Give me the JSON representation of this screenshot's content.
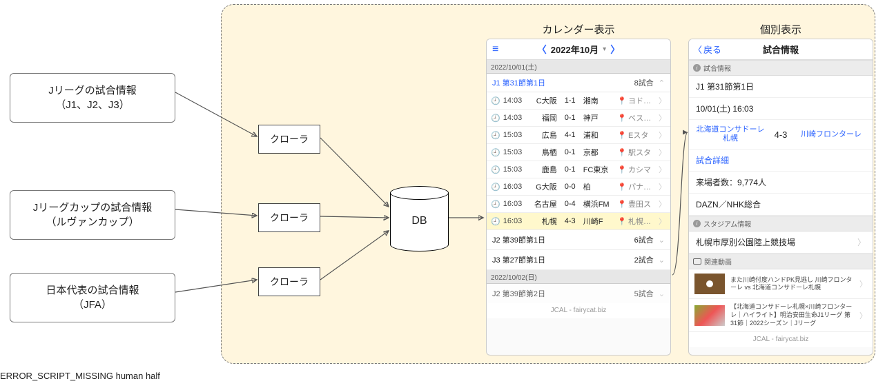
{
  "sources": [
    {
      "title": "Jリーグの試合情報",
      "subtitle": "（J1、J2、J3）"
    },
    {
      "title": "Jリーグカップの試合情報",
      "subtitle": "（ルヴァンカップ）"
    },
    {
      "title": "日本代表の試合情報",
      "subtitle": "（JFA）"
    }
  ],
  "crawler_label": "クローラ",
  "db_label": "DB",
  "calendar": {
    "panel_title": "カレンダー表示",
    "month": "2022年10月",
    "date_bar_1": "2022/10/01(土)",
    "section_j1": {
      "title": "J1 第31節第1日",
      "count": "8試合"
    },
    "rows": [
      {
        "time": "14:03",
        "home": "C大阪",
        "score": "1-1",
        "away": "湘南",
        "venue": "ヨドコウ"
      },
      {
        "time": "14:03",
        "home": "福岡",
        "score": "0-1",
        "away": "神戸",
        "venue": "ベススタ"
      },
      {
        "time": "15:03",
        "home": "広島",
        "score": "4-1",
        "away": "浦和",
        "venue": "Eスタ"
      },
      {
        "time": "15:03",
        "home": "鳥栖",
        "score": "0-1",
        "away": "京都",
        "venue": "駅スタ"
      },
      {
        "time": "15:03",
        "home": "鹿島",
        "score": "0-1",
        "away": "FC東京",
        "venue": "カシマ"
      },
      {
        "time": "16:03",
        "home": "G大阪",
        "score": "0-0",
        "away": "柏",
        "venue": "パナスタ"
      },
      {
        "time": "16:03",
        "home": "名古屋",
        "score": "0-4",
        "away": "横浜FM",
        "venue": "豊田ス"
      },
      {
        "time": "16:03",
        "home": "札幌",
        "score": "4-3",
        "away": "川崎F",
        "venue": "札幌厚別"
      }
    ],
    "block_j2": {
      "title": "J2 第39節第1日",
      "count": "6試合"
    },
    "block_j3": {
      "title": "J3 第27節第1日",
      "count": "2試合"
    },
    "date_bar_2": "2022/10/02(日)",
    "block_j2b": {
      "title": "J2 第39節第2日",
      "count": "5試合"
    },
    "footer": "JCAL - fairycat.biz"
  },
  "detail": {
    "panel_title": "個別表示",
    "back_label": "戻る",
    "header_title": "試合情報",
    "sec_match": "試合情報",
    "round": "J1 第31節第1日",
    "datetime": "10/01(土) 16:03",
    "team_home": "北海道コンサドーレ札幌",
    "score": "4-3",
    "team_away": "川崎フロンターレ",
    "detail_link": "試合詳細",
    "attendance": "来場者数：9,774人",
    "broadcast": "DAZN／NHK総合",
    "sec_stadium": "スタジアム情報",
    "stadium_name": "札幌市厚別公園陸上競技場",
    "sec_video": "関連動画",
    "video1": "また川崎付度ハンドPK見逃し 川崎フロンターレ vs 北海道コンサドーレ札幌",
    "video2": "【北海道コンサドーレ札幌×川崎フロンターレ｜ハイライト】明治安田生命J1リーグ 第31節｜2022シーズン｜Jリーグ",
    "footer": "JCAL - fairycat.biz"
  }
}
